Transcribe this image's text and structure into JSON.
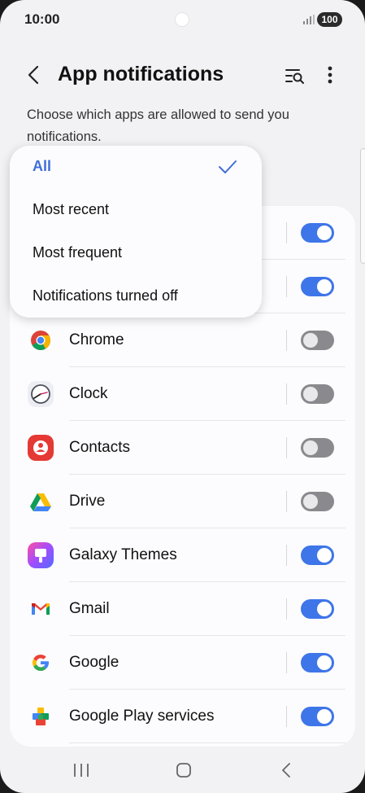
{
  "status_bar": {
    "time": "10:00",
    "battery": "100"
  },
  "header": {
    "title": "App notifications",
    "description": "Choose which apps are allowed to send you notifications."
  },
  "sort_menu": {
    "options": [
      {
        "label": "All",
        "selected": true
      },
      {
        "label": "Most recent",
        "selected": false
      },
      {
        "label": "Most frequent",
        "selected": false
      },
      {
        "label": "Notifications turned off",
        "selected": false
      }
    ]
  },
  "apps": [
    {
      "name": "",
      "icon": "hidden-app-icon",
      "enabled": true
    },
    {
      "name": "",
      "icon": "hidden-app-icon",
      "enabled": true
    },
    {
      "name": "Chrome",
      "icon": "chrome-icon",
      "enabled": false
    },
    {
      "name": "Clock",
      "icon": "clock-icon",
      "enabled": false
    },
    {
      "name": "Contacts",
      "icon": "contacts-icon",
      "enabled": false
    },
    {
      "name": "Drive",
      "icon": "drive-icon",
      "enabled": false
    },
    {
      "name": "Galaxy Themes",
      "icon": "galaxy-themes-icon",
      "enabled": true
    },
    {
      "name": "Gmail",
      "icon": "gmail-icon",
      "enabled": true
    },
    {
      "name": "Google",
      "icon": "google-icon",
      "enabled": true
    },
    {
      "name": "Google Play services",
      "icon": "google-play-services-icon",
      "enabled": true
    }
  ],
  "colors": {
    "accent": "#3e75e8",
    "toggle_off": "#8a8a8e",
    "background": "#f2f2f4"
  }
}
